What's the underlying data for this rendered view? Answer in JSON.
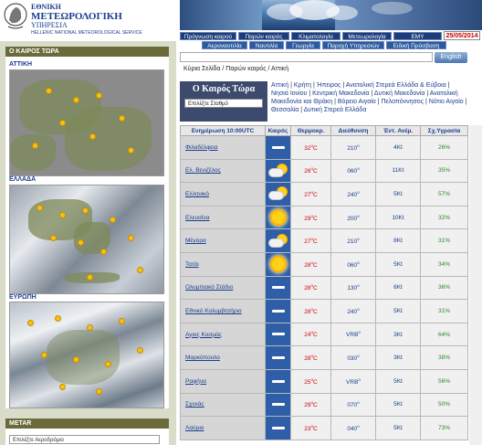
{
  "header": {
    "logo_line1": "ΕΘΝΙΚΗ",
    "logo_line2": "ΜΕΤΕΩΡΟΛΟΓΙΚΗ",
    "logo_line3": "ΥΠΗΡΕΣΙΑ",
    "logo_line4": "HELLENIC NATIONAL METEOROLOGICAL SERVICE",
    "nav_row1": [
      "Πρόγνωση καιρού",
      "Παρών καιρός",
      "Κλιματολογία",
      "Μετεωρολογία",
      "ΕΜΥ"
    ],
    "nav_row2": [
      "Αεροναυτιλία",
      "Ναυτιλία",
      "Γεωργία",
      "Παροχή Υπηρεσιών",
      "Ειδική Πρόσβαση"
    ],
    "date": "25/05/2014",
    "search_button": "English",
    "breadcrumb": "Κύρια Σελίδα / Παρών καιρός / Αττική"
  },
  "left": {
    "now_title": "Ο ΚΑΙΡΟΣ ΤΩΡΑ",
    "regions": [
      "ΑΤΤΙΚΗ",
      "ΕΛΛΑΔΑ",
      "ΕΥΡΩΠΗ"
    ],
    "metar_title": "METAR",
    "metar_select": "Επιλέξτε Αεροδρόμιο"
  },
  "weather_now": {
    "title": "Ο Καιρός Τώρα",
    "station_select": "Επιλέξτε Σταθμό"
  },
  "region_links": [
    "Αττική",
    "Κρήτη",
    "Ήπειρος",
    "Ανατολική Στερεά Ελλάδα & Εύβοια",
    "Νησιά Ιονίου",
    "Κεντρική Μακεδονία",
    "Δυτική Μακεδονία",
    "Ανατολική Μακεδονία και Θράκη",
    "Βόρειο Αιγαίο",
    "Πελοπόννησος",
    "Νότιο Αιγαίο",
    "Θεσσαλία",
    "Δυτική Στερεά Ελλάδα"
  ],
  "table": {
    "headers": [
      "Ενημέρωση 10:00UTC",
      "Καιρός",
      "Θερμοκρ.",
      "Διεύθυνση",
      "Έντ. Ανέμ.",
      "Σχ.Υγρασία"
    ],
    "rows": [
      {
        "station": "Φιλαδέλφεια",
        "icon": "dash",
        "temp": "32",
        "dir": "210",
        "wind": "4Kt",
        "hum": "26%"
      },
      {
        "station": "Ελ. Βενιζέλος",
        "icon": "sun-cloud",
        "temp": "26",
        "dir": "060",
        "wind": "11Kt",
        "hum": "35%"
      },
      {
        "station": "Ελληνικό",
        "icon": "sun-cloud",
        "temp": "27",
        "dir": "240",
        "wind": "5Kt",
        "hum": "57%"
      },
      {
        "station": "Ελευσίνα",
        "icon": "sun",
        "temp": "29",
        "dir": "200",
        "wind": "10Kt",
        "hum": "32%"
      },
      {
        "station": "Μέγαρα",
        "icon": "sun-cloud",
        "temp": "27",
        "dir": "210",
        "wind": "8Kt",
        "hum": "31%"
      },
      {
        "station": "Τατόι",
        "icon": "sun",
        "temp": "28",
        "dir": "060",
        "wind": "5Kt",
        "hum": "34%"
      },
      {
        "station": "Ολυμπιακό Στάδιο",
        "icon": "dash",
        "temp": "28",
        "dir": "130",
        "wind": "6Kt",
        "hum": "36%"
      },
      {
        "station": "Εθνικό Κολυμβητήριο",
        "icon": "dash",
        "temp": "28",
        "dir": "240",
        "wind": "5Kt",
        "hum": "31%"
      },
      {
        "station": "Αγιος Κοσμάς",
        "icon": "dash",
        "temp": "24",
        "dir": "VRB",
        "wind": "3Kt",
        "hum": "64%"
      },
      {
        "station": "Μαρκόπουλο",
        "icon": "dash",
        "temp": "28",
        "dir": "030",
        "wind": "3Kt",
        "hum": "38%"
      },
      {
        "station": "Ραφήνα",
        "icon": "dash",
        "temp": "25",
        "dir": "VRB",
        "wind": "5Kt",
        "hum": "56%"
      },
      {
        "station": "Σχινιάς",
        "icon": "dash",
        "temp": "29",
        "dir": "070",
        "wind": "5Kt",
        "hum": "50%"
      },
      {
        "station": "Λαύριο",
        "icon": "dash",
        "temp": "23",
        "dir": "040",
        "wind": "5Kt",
        "hum": "73%"
      }
    ]
  },
  "colors": {
    "nav_bg": "#1c3c7a",
    "table_icon_bg": "#2f5ea8",
    "temp_red": "#d00000",
    "hum_green": "#2b8a2b"
  }
}
